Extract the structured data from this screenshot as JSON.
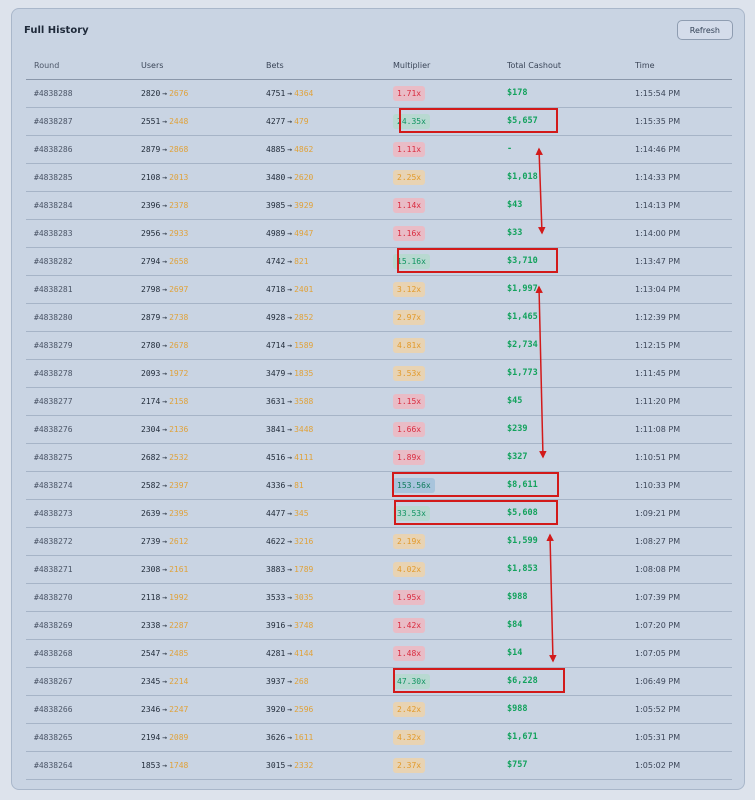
{
  "panel": {
    "title": "Full History",
    "refresh_label": "Refresh"
  },
  "columns": {
    "round": "Round",
    "users": "Users",
    "bets": "Bets",
    "multiplier": "Multiplier",
    "cashout": "Total Cashout",
    "time": "Time"
  },
  "arrow_glyph": "→",
  "colors": {
    "red": "#d92b3f",
    "orange": "#e39a2a",
    "green": "#109461",
    "cashout": "#13a25d",
    "highlight": "#d21a1a"
  },
  "rows": [
    {
      "round": "#4838288",
      "users_from": "2820",
      "users_to": "2676",
      "bets_from": "4751",
      "bets_to": "4364",
      "multiplier": "1.71x",
      "mult_tone": "red",
      "cashout": "$178",
      "time": "1:15:54 PM"
    },
    {
      "round": "#4838287",
      "users_from": "2551",
      "users_to": "2448",
      "bets_from": "4277",
      "bets_to": "479",
      "multiplier": "24.35x",
      "mult_tone": "green",
      "cashout": "$5,657",
      "time": "1:15:35 PM"
    },
    {
      "round": "#4838286",
      "users_from": "2879",
      "users_to": "2868",
      "bets_from": "4885",
      "bets_to": "4862",
      "multiplier": "1.11x",
      "mult_tone": "red",
      "cashout": "-",
      "time": "1:14:46 PM"
    },
    {
      "round": "#4838285",
      "users_from": "2108",
      "users_to": "2013",
      "bets_from": "3480",
      "bets_to": "2620",
      "multiplier": "2.25x",
      "mult_tone": "orange",
      "cashout": "$1,018",
      "time": "1:14:33 PM"
    },
    {
      "round": "#4838284",
      "users_from": "2396",
      "users_to": "2378",
      "bets_from": "3985",
      "bets_to": "3929",
      "multiplier": "1.14x",
      "mult_tone": "red",
      "cashout": "$43",
      "time": "1:14:13 PM"
    },
    {
      "round": "#4838283",
      "users_from": "2956",
      "users_to": "2933",
      "bets_from": "4989",
      "bets_to": "4947",
      "multiplier": "1.16x",
      "mult_tone": "red",
      "cashout": "$33",
      "time": "1:14:00 PM"
    },
    {
      "round": "#4838282",
      "users_from": "2794",
      "users_to": "2658",
      "bets_from": "4742",
      "bets_to": "821",
      "multiplier": "15.16x",
      "mult_tone": "green",
      "cashout": "$3,710",
      "time": "1:13:47 PM"
    },
    {
      "round": "#4838281",
      "users_from": "2798",
      "users_to": "2697",
      "bets_from": "4718",
      "bets_to": "2401",
      "multiplier": "3.12x",
      "mult_tone": "orange",
      "cashout": "$1,997",
      "time": "1:13:04 PM"
    },
    {
      "round": "#4838280",
      "users_from": "2879",
      "users_to": "2738",
      "bets_from": "4928",
      "bets_to": "2852",
      "multiplier": "2.97x",
      "mult_tone": "orange",
      "cashout": "$1,465",
      "time": "1:12:39 PM"
    },
    {
      "round": "#4838279",
      "users_from": "2780",
      "users_to": "2678",
      "bets_from": "4714",
      "bets_to": "1589",
      "multiplier": "4.81x",
      "mult_tone": "orange",
      "cashout": "$2,734",
      "time": "1:12:15 PM"
    },
    {
      "round": "#4838278",
      "users_from": "2093",
      "users_to": "1972",
      "bets_from": "3479",
      "bets_to": "1835",
      "multiplier": "3.53x",
      "mult_tone": "orange",
      "cashout": "$1,773",
      "time": "1:11:45 PM"
    },
    {
      "round": "#4838277",
      "users_from": "2174",
      "users_to": "2158",
      "bets_from": "3631",
      "bets_to": "3588",
      "multiplier": "1.15x",
      "mult_tone": "red",
      "cashout": "$45",
      "time": "1:11:20 PM"
    },
    {
      "round": "#4838276",
      "users_from": "2304",
      "users_to": "2136",
      "bets_from": "3841",
      "bets_to": "3448",
      "multiplier": "1.66x",
      "mult_tone": "red",
      "cashout": "$239",
      "time": "1:11:08 PM"
    },
    {
      "round": "#4838275",
      "users_from": "2682",
      "users_to": "2532",
      "bets_from": "4516",
      "bets_to": "4111",
      "multiplier": "1.89x",
      "mult_tone": "red",
      "cashout": "$327",
      "time": "1:10:51 PM"
    },
    {
      "round": "#4838274",
      "users_from": "2582",
      "users_to": "2397",
      "bets_from": "4336",
      "bets_to": "81",
      "multiplier": "153.56x",
      "mult_tone": "blue",
      "cashout": "$8,611",
      "time": "1:10:33 PM"
    },
    {
      "round": "#4838273",
      "users_from": "2639",
      "users_to": "2395",
      "bets_from": "4477",
      "bets_to": "345",
      "multiplier": "33.53x",
      "mult_tone": "green",
      "cashout": "$5,608",
      "time": "1:09:21 PM"
    },
    {
      "round": "#4838272",
      "users_from": "2739",
      "users_to": "2612",
      "bets_from": "4622",
      "bets_to": "3216",
      "multiplier": "2.19x",
      "mult_tone": "orange",
      "cashout": "$1,599",
      "time": "1:08:27 PM"
    },
    {
      "round": "#4838271",
      "users_from": "2308",
      "users_to": "2161",
      "bets_from": "3883",
      "bets_to": "1789",
      "multiplier": "4.02x",
      "mult_tone": "orange",
      "cashout": "$1,853",
      "time": "1:08:08 PM"
    },
    {
      "round": "#4838270",
      "users_from": "2118",
      "users_to": "1992",
      "bets_from": "3533",
      "bets_to": "3035",
      "multiplier": "1.95x",
      "mult_tone": "red",
      "cashout": "$988",
      "time": "1:07:39 PM"
    },
    {
      "round": "#4838269",
      "users_from": "2338",
      "users_to": "2287",
      "bets_from": "3916",
      "bets_to": "3748",
      "multiplier": "1.42x",
      "mult_tone": "red",
      "cashout": "$84",
      "time": "1:07:20 PM"
    },
    {
      "round": "#4838268",
      "users_from": "2547",
      "users_to": "2485",
      "bets_from": "4281",
      "bets_to": "4144",
      "multiplier": "1.48x",
      "mult_tone": "red",
      "cashout": "$14",
      "time": "1:07:05 PM"
    },
    {
      "round": "#4838267",
      "users_from": "2345",
      "users_to": "2214",
      "bets_from": "3937",
      "bets_to": "268",
      "multiplier": "47.30x",
      "mult_tone": "green",
      "cashout": "$6,228",
      "time": "1:06:49 PM"
    },
    {
      "round": "#4838266",
      "users_from": "2346",
      "users_to": "2247",
      "bets_from": "3920",
      "bets_to": "2596",
      "multiplier": "2.42x",
      "mult_tone": "orange",
      "cashout": "$988",
      "time": "1:05:52 PM"
    },
    {
      "round": "#4838265",
      "users_from": "2194",
      "users_to": "2089",
      "bets_from": "3626",
      "bets_to": "1611",
      "multiplier": "4.32x",
      "mult_tone": "orange",
      "cashout": "$1,671",
      "time": "1:05:31 PM"
    },
    {
      "round": "#4838264",
      "users_from": "1853",
      "users_to": "1748",
      "bets_from": "3015",
      "bets_to": "2332",
      "multiplier": "2.37x",
      "mult_tone": "orange",
      "cashout": "$757",
      "time": "1:05:02 PM"
    }
  ]
}
